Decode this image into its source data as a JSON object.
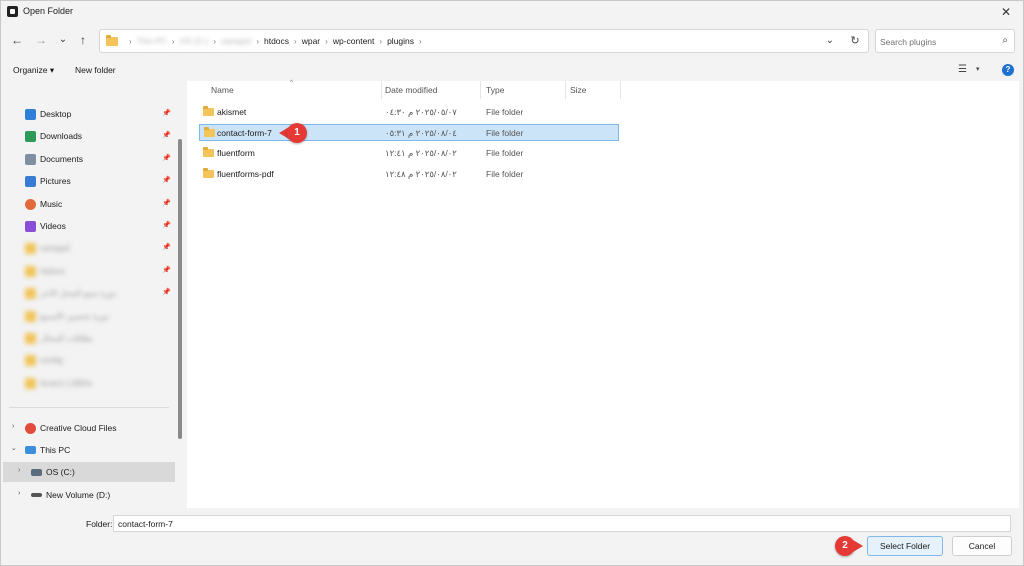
{
  "window": {
    "title": "Open Folder",
    "close_glyph": "✕"
  },
  "toolbar": {
    "back_glyph": "←",
    "forward_glyph": "→",
    "recent_glyph": "⌄",
    "up_glyph": "↑"
  },
  "address": {
    "segments": [
      {
        "label": "This PC",
        "blurred": true
      },
      {
        "label": "OS (C:)",
        "blurred": true
      },
      {
        "label": "xampp2",
        "blurred": true
      },
      {
        "label": "htdocs",
        "blurred": false
      },
      {
        "label": "wpar",
        "blurred": false
      },
      {
        "label": "wp-content",
        "blurred": false
      },
      {
        "label": "plugins",
        "blurred": false
      }
    ],
    "separator": "›",
    "dropdown_glyph": "⌄",
    "refresh_glyph": "↻"
  },
  "search": {
    "placeholder": "Search plugins",
    "icon_glyph": "⌕"
  },
  "commands": {
    "organize": "Organize ▾",
    "new_folder": "New folder",
    "help": "?",
    "view_glyph": "☰",
    "view_chevron": "▾"
  },
  "nav": {
    "quick": [
      {
        "label": "Desktop",
        "icon": "desktop-icon",
        "color": "#2f7fd6"
      },
      {
        "label": "Downloads",
        "icon": "downloads-icon",
        "color": "#2e9a5a"
      },
      {
        "label": "Documents",
        "icon": "documents-icon",
        "color": "#7f8ea3"
      },
      {
        "label": "Pictures",
        "icon": "pictures-icon",
        "color": "#3a7bd5"
      },
      {
        "label": "Music",
        "icon": "music-icon",
        "color": "#e06a3a"
      },
      {
        "label": "Videos",
        "icon": "videos-icon",
        "color": "#8a4fd6"
      }
    ],
    "blurred_folders": [
      "xampp2",
      "htdocs",
      "دورة سيو المحل الاخر",
      "دورة تحسين الاسمع",
      "بطاقات المحال",
      "config",
      "Scan1 LSBAs"
    ],
    "creative_cloud": "Creative Cloud Files",
    "this_pc": "This PC",
    "drives": [
      {
        "label": "OS (C:)",
        "selected": true
      },
      {
        "label": "New Volume (D:)",
        "selected": false
      }
    ],
    "pin_glyph": "📌",
    "expand_glyph": "›",
    "expanded_glyph": "⌄"
  },
  "columns": {
    "name": "Name",
    "date": "Date modified",
    "type": "Type",
    "size": "Size",
    "sort_glyph": "^"
  },
  "files": [
    {
      "name": "akismet",
      "date": "٢٠٢٥/٠٥/٠٧ م ٠٤:٣٠",
      "type": "File folder",
      "selected": false
    },
    {
      "name": "contact-form-7",
      "date": "٢٠٢٥/٠٨/٠٤ م ٠٥:٣١",
      "type": "File folder",
      "selected": true
    },
    {
      "name": "fluentform",
      "date": "٢٠٢٥/٠٨/٠٢ م ١٢:٤١",
      "type": "File folder",
      "selected": false
    },
    {
      "name": "fluentforms-pdf",
      "date": "٢٠٢٥/٠٨/٠٢ م ١٢:٤٨",
      "type": "File folder",
      "selected": false
    }
  ],
  "footer": {
    "folder_label": "Folder:",
    "folder_value": "contact-form-7",
    "select_button": "Select Folder",
    "cancel_button": "Cancel"
  },
  "markers": {
    "one": "1",
    "two": "2"
  }
}
